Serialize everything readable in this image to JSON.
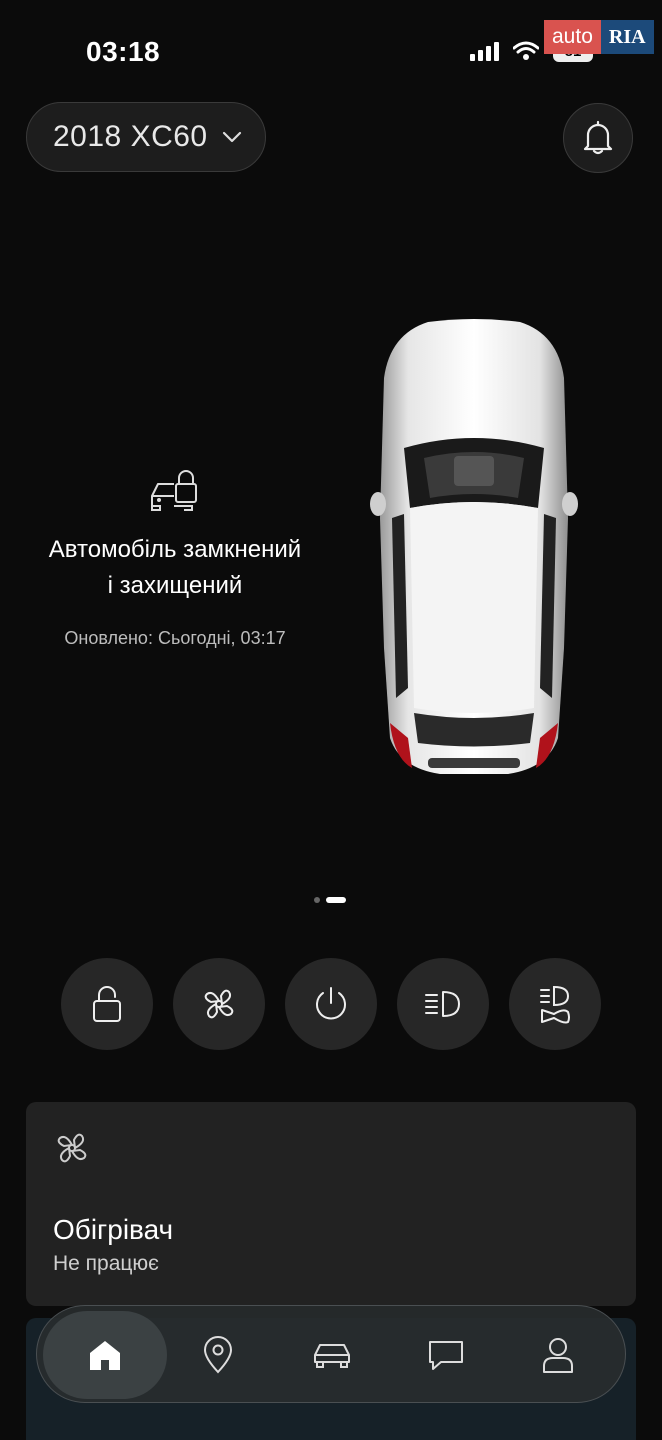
{
  "status_bar": {
    "time": "03:18",
    "battery": "81"
  },
  "watermark": {
    "auto": "auto",
    "ria": "RIA"
  },
  "header": {
    "vehicle_name": "2018 XC60"
  },
  "lock_status": {
    "line1": "Автомобіль замкнений",
    "line2": "і захищений",
    "updated": "Оновлено: Сьогодні, 03:17"
  },
  "quick_actions": [
    {
      "icon": "lock-icon"
    },
    {
      "icon": "fan-icon"
    },
    {
      "icon": "power-icon"
    },
    {
      "icon": "headlights-icon"
    },
    {
      "icon": "horn-lights-icon"
    }
  ],
  "heater_card": {
    "title": "Обігрівач",
    "status": "Не працює"
  },
  "tabs": [
    {
      "icon": "home-icon",
      "active": true
    },
    {
      "icon": "map-pin-icon"
    },
    {
      "icon": "car-icon"
    },
    {
      "icon": "chat-icon"
    },
    {
      "icon": "profile-icon"
    }
  ],
  "pager": {
    "count": 2,
    "active_index": 1
  }
}
